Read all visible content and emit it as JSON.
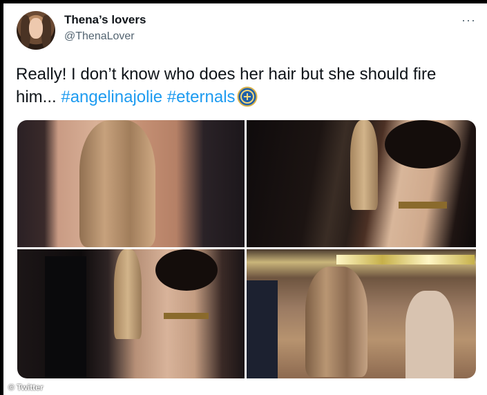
{
  "tweet": {
    "author_name": "Thena’s lovers",
    "author_handle": "@ThenaLover",
    "text_plain": "Really! I don’t know who does her hair but she should fire him... ",
    "hashtag_1": "#angelinajolie",
    "hashtag_2": "#eternals",
    "more_label": "···"
  },
  "media": {
    "photos": [
      {
        "alt": ""
      },
      {
        "alt": ""
      },
      {
        "alt": ""
      },
      {
        "alt": ""
      }
    ]
  },
  "watermark": "© Twitter",
  "icons": {
    "more": "more-dots-icon",
    "emoji": "eternals-emoji-icon"
  },
  "colors": {
    "link": "#1d9bf0",
    "text": "#0f1419",
    "secondary": "#536471"
  }
}
